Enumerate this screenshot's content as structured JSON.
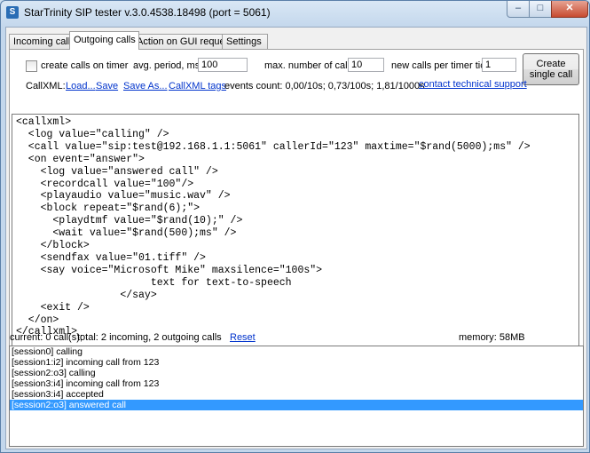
{
  "window": {
    "title": "StarTrinity SIP tester v.3.0.4538.18498 (port = 5061)",
    "controls": {
      "minimize": "–",
      "maximize": "□",
      "close": "✕"
    }
  },
  "tabs": [
    {
      "label": "Incoming calls",
      "active": false
    },
    {
      "label": "Outgoing calls",
      "active": true
    },
    {
      "label": "Action on GUI request",
      "active": false
    },
    {
      "label": "Settings",
      "active": false
    }
  ],
  "outgoing": {
    "create_calls_on_timer": {
      "label": "create calls on timer",
      "checked": false
    },
    "avg_period": {
      "label": "avg. period, ms:",
      "value": "100"
    },
    "max_calls": {
      "label": "max. number of calls:",
      "value": "10"
    },
    "calls_per_tick": {
      "label": "new calls per timer tick:",
      "value": "1"
    },
    "create_single_call_button": "Create\nsingle call",
    "callxml_label": "CallXML:",
    "load_link": "Load...",
    "save_link": "Save",
    "save_as_link": "Save As...",
    "callxml_tags_link": "CallXML tags",
    "events_count": "events count: 0,00/10s; 0,73/100s; 1,81/1000s",
    "support_link": "contact technical support",
    "script": "<callxml>\n  <log value=\"calling\" />\n  <call value=\"sip:test@192.168.1.1:5061\" callerId=\"123\" maxtime=\"$rand(5000);ms\" />\n  <on event=\"answer\">\n    <log value=\"answered call\" />\n    <recordcall value=\"100\"/>\n    <playaudio value=\"music.wav\" />\n    <block repeat=\"$rand(6);\">\n      <playdtmf value=\"$rand(10);\" />\n      <wait value=\"$rand(500);ms\" />\n    </block>\n    <sendfax value=\"01.tiff\" />\n    <say voice=\"Microsoft Mike\" maxsilence=\"100s\">\n                      text for text-to-speech\n                 </say>\n    <exit />\n  </on>\n</callxml>"
  },
  "status": {
    "current": "current: 0 call(s);",
    "total": "total: 2 incoming, 2 outgoing calls",
    "reset_link": "Reset",
    "memory": "memory: 58MB"
  },
  "log": [
    {
      "text": "[session0] calling",
      "selected": false
    },
    {
      "text": "[session1:i2] incoming call from 123",
      "selected": false
    },
    {
      "text": "[session2:o3] calling",
      "selected": false
    },
    {
      "text": "[session3:i4] incoming call from 123",
      "selected": false
    },
    {
      "text": "[session3:i4] accepted",
      "selected": false
    },
    {
      "text": "[session2:o3] answered call",
      "selected": true
    }
  ],
  "colors": {
    "selection": "#3399ff",
    "link": "#0033cc",
    "close_button": "#c74b30"
  }
}
